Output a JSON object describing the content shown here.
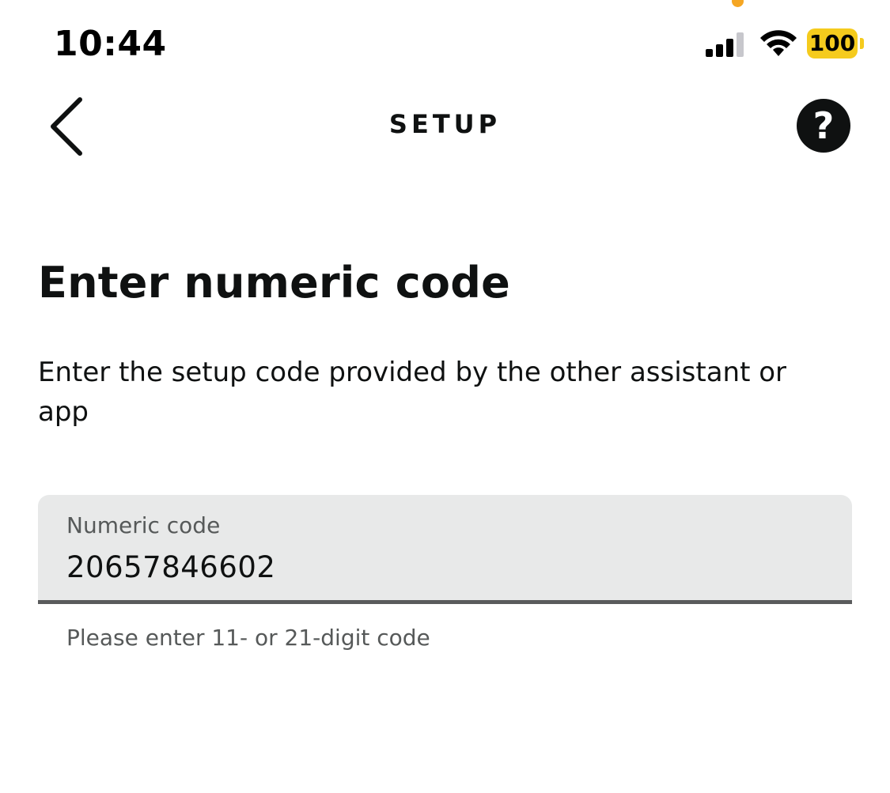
{
  "status_bar": {
    "time": "10:44",
    "battery_level": "100",
    "signal_bars_active": 3,
    "signal_bars_total": 4,
    "accent_colors": {
      "battery": "#f5cb1d",
      "privacy_dot": "#f5a623"
    }
  },
  "nav": {
    "title": "SETUP",
    "back_icon": "chevron-left-icon",
    "help_icon": "question-mark-icon",
    "help_glyph": "?"
  },
  "content": {
    "heading": "Enter numeric code",
    "description": "Enter the setup code provided by the other assistant or app",
    "field": {
      "label": "Numeric code",
      "value": "20657846602"
    },
    "helper_text": "Please enter 11- or 21-digit code"
  }
}
